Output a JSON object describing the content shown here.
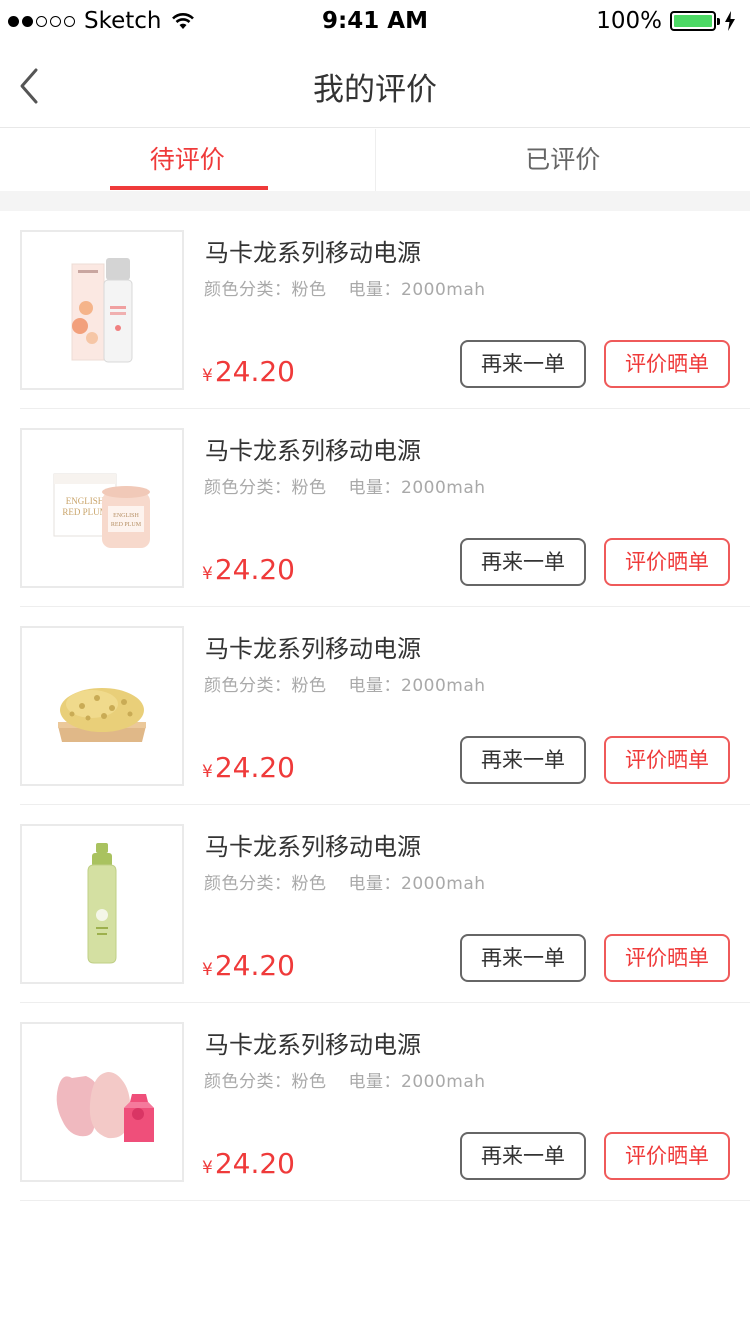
{
  "status_bar": {
    "carrier": "Sketch",
    "time": "9:41 AM",
    "battery": "100%",
    "battery_color": "#4cd964"
  },
  "nav": {
    "title": "我的评价"
  },
  "tabs": [
    {
      "label": "待评价",
      "active": true
    },
    {
      "label": "已评价",
      "active": false
    }
  ],
  "accent_color": "#ef3a3a",
  "items": [
    {
      "name": "马卡龙系列移动电源",
      "color_label": "颜色分类：粉色",
      "capacity_label": "电量：2000mah",
      "currency": "¥",
      "price": "24.20",
      "image": "peach-serum-bottle",
      "again_label": "再来一单",
      "review_label": "评价晒单"
    },
    {
      "name": "马卡龙系列移动电源",
      "color_label": "颜色分类：粉色",
      "capacity_label": "电量：2000mah",
      "currency": "¥",
      "price": "24.20",
      "image": "english-red-plum-candle",
      "again_label": "再来一单",
      "review_label": "评价晒单",
      "image_text_1": "ENGLISH",
      "image_text_2": "RED PLUM"
    },
    {
      "name": "马卡龙系列移动电源",
      "color_label": "颜色分类：粉色",
      "capacity_label": "电量：2000mah",
      "currency": "¥",
      "price": "24.20",
      "image": "sea-sponge-on-tray",
      "again_label": "再来一单",
      "review_label": "评价晒单"
    },
    {
      "name": "马卡龙系列移动电源",
      "color_label": "颜色分类：粉色",
      "capacity_label": "电量：2000mah",
      "currency": "¥",
      "price": "24.20",
      "image": "green-toner-bottle",
      "again_label": "再来一单",
      "review_label": "评价晒单"
    },
    {
      "name": "马卡龙系列移动电源",
      "color_label": "颜色分类：粉色",
      "capacity_label": "电量：2000mah",
      "currency": "¥",
      "price": "24.20",
      "image": "makeup-sponges",
      "again_label": "再来一单",
      "review_label": "评价晒单"
    }
  ]
}
